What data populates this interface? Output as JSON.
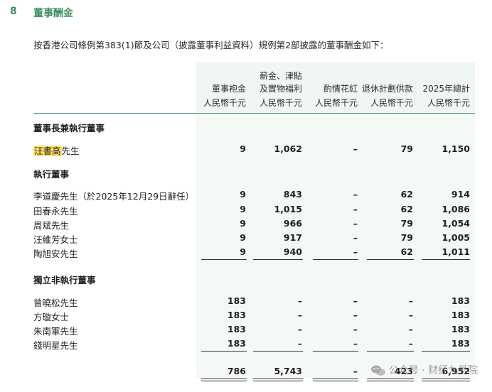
{
  "section": {
    "number": "8",
    "title": "董事酬金",
    "intro": "按香港公司條例第383(1)節及公司（披露董事利益資料）規例第2部披露的董事酬金如下："
  },
  "table": {
    "columns": [
      {
        "line1": "",
        "line2": "董事袍金",
        "unit": "人民幣千元"
      },
      {
        "line1": "薪金、津貼",
        "line2": "及實物福利",
        "unit": "人民幣千元"
      },
      {
        "line1": "",
        "line2": "酌情花紅",
        "unit": "人民幣千元"
      },
      {
        "line1": "",
        "line2": "退休計劃供款",
        "unit": "人民幣千元"
      },
      {
        "line1": "",
        "line2": "2025年總計",
        "unit": "人民幣千元"
      }
    ],
    "group1": {
      "title": "董事長兼執行董事",
      "rows": [
        {
          "name": "汪書高",
          "suffix": "先生",
          "values": [
            "9",
            "1,062",
            "–",
            "79",
            "1,150"
          ]
        }
      ]
    },
    "group2": {
      "title": "執行董事",
      "rows": [
        {
          "name": "李道慶先生（於2025年12月29日辭任）",
          "values": [
            "9",
            "843",
            "–",
            "62",
            "914"
          ]
        },
        {
          "name": "田春永先生",
          "values": [
            "9",
            "1,015",
            "–",
            "62",
            "1,086"
          ]
        },
        {
          "name": "周斌先生",
          "values": [
            "9",
            "966",
            "–",
            "79",
            "1,054"
          ]
        },
        {
          "name": "汪維芳女士",
          "values": [
            "9",
            "917",
            "–",
            "79",
            "1,005"
          ]
        },
        {
          "name": "陶旭安先生",
          "values": [
            "9",
            "940",
            "–",
            "62",
            "1,011"
          ]
        }
      ]
    },
    "group3": {
      "title": "獨立非執行董事",
      "rows": [
        {
          "name": "曾曉松先生",
          "values": [
            "183",
            "–",
            "–",
            "–",
            "183"
          ]
        },
        {
          "name": "方璇女士",
          "values": [
            "183",
            "–",
            "–",
            "–",
            "183"
          ]
        },
        {
          "name": "朱南軍先生",
          "values": [
            "183",
            "–",
            "–",
            "–",
            "183"
          ]
        },
        {
          "name": "錢明星先生",
          "values": [
            "183",
            "–",
            "–",
            "–",
            "183"
          ]
        }
      ]
    },
    "totals": [
      "786",
      "5,743",
      "–",
      "423",
      "6,952"
    ]
  },
  "watermark": {
    "text": "公众号 · 财经九号院",
    "icon": "wechat-icon"
  }
}
